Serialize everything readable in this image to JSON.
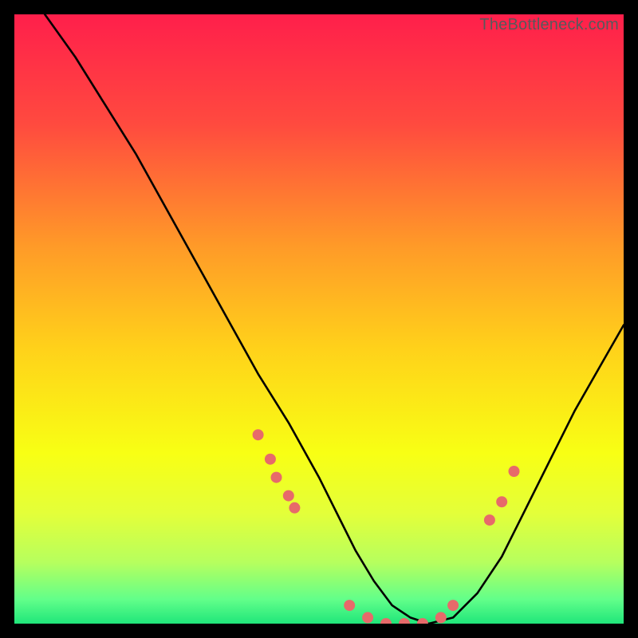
{
  "watermark": "TheBottleneck.com",
  "chart_data": {
    "type": "line",
    "title": "",
    "xlabel": "",
    "ylabel": "",
    "xlim": [
      0,
      100
    ],
    "ylim": [
      0,
      100
    ],
    "gradient_stops": [
      {
        "offset": 0.0,
        "color": "#ff1f4b"
      },
      {
        "offset": 0.18,
        "color": "#ff4a3f"
      },
      {
        "offset": 0.38,
        "color": "#ff9a28"
      },
      {
        "offset": 0.55,
        "color": "#ffd21a"
      },
      {
        "offset": 0.72,
        "color": "#f8ff14"
      },
      {
        "offset": 0.82,
        "color": "#e3ff3a"
      },
      {
        "offset": 0.9,
        "color": "#b6ff5e"
      },
      {
        "offset": 0.96,
        "color": "#62ff8a"
      },
      {
        "offset": 1.0,
        "color": "#20e67a"
      }
    ],
    "series": [
      {
        "name": "bottleneck-curve",
        "x": [
          5,
          10,
          15,
          20,
          25,
          30,
          35,
          40,
          45,
          50,
          53,
          56,
          59,
          62,
          65,
          68,
          72,
          76,
          80,
          84,
          88,
          92,
          96,
          100
        ],
        "y": [
          100,
          93,
          85,
          77,
          68,
          59,
          50,
          41,
          33,
          24,
          18,
          12,
          7,
          3,
          1,
          0,
          1,
          5,
          11,
          19,
          27,
          35,
          42,
          49
        ]
      }
    ],
    "markers": {
      "name": "highlighted-points",
      "color": "#e76a6a",
      "points": [
        {
          "x": 40,
          "y": 31
        },
        {
          "x": 42,
          "y": 27
        },
        {
          "x": 43,
          "y": 24
        },
        {
          "x": 45,
          "y": 21
        },
        {
          "x": 46,
          "y": 19
        },
        {
          "x": 55,
          "y": 3
        },
        {
          "x": 58,
          "y": 1
        },
        {
          "x": 61,
          "y": 0
        },
        {
          "x": 64,
          "y": 0
        },
        {
          "x": 67,
          "y": 0
        },
        {
          "x": 70,
          "y": 1
        },
        {
          "x": 72,
          "y": 3
        },
        {
          "x": 78,
          "y": 17
        },
        {
          "x": 80,
          "y": 20
        },
        {
          "x": 82,
          "y": 25
        }
      ]
    }
  }
}
